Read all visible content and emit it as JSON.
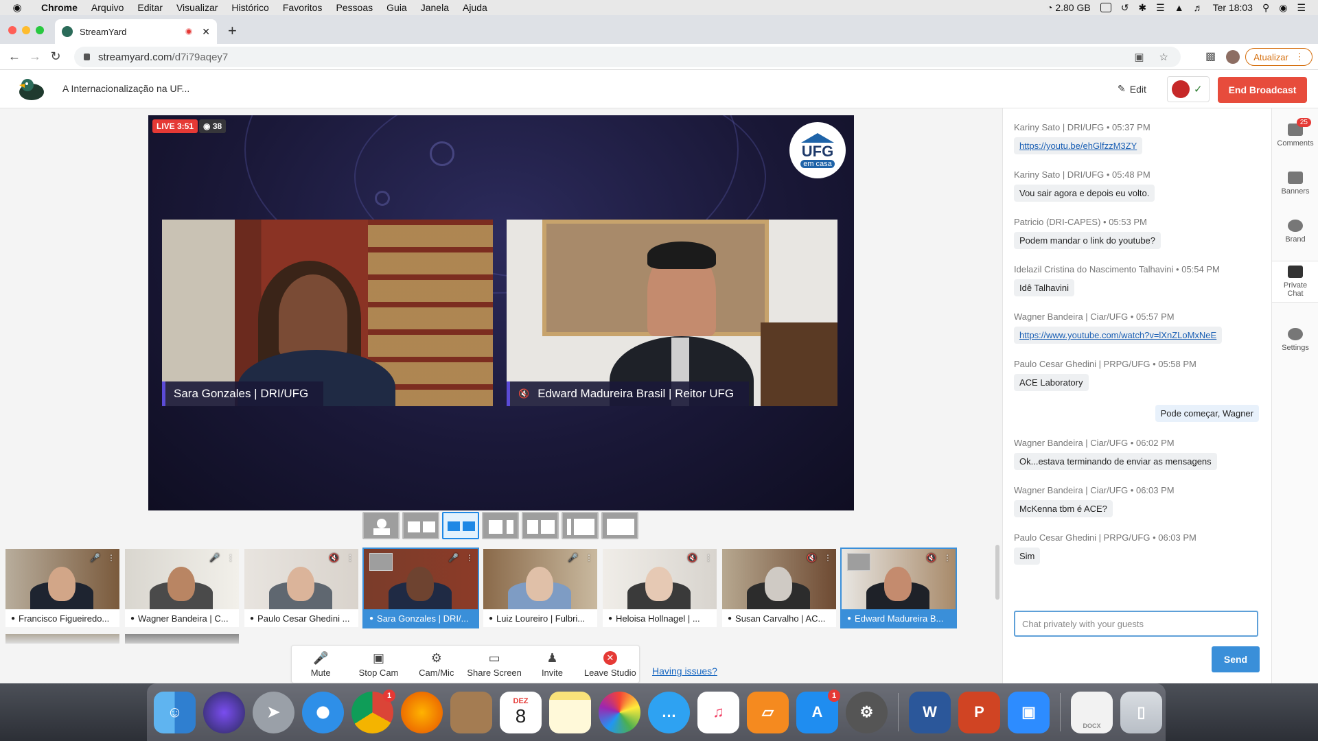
{
  "menubar": {
    "apple": "",
    "items": [
      "Chrome",
      "Arquivo",
      "Editar",
      "Visualizar",
      "Histórico",
      "Favoritos",
      "Pessoas",
      "Guia",
      "Janela",
      "Ajuda"
    ],
    "memory": "2.80 GB",
    "clock": "Ter 18:03"
  },
  "browser": {
    "tab_title": "StreamYard",
    "new_tab": "+",
    "url_host": "streamyard.com",
    "url_path": "/d7i79aqey7",
    "update_label": "Atualizar"
  },
  "app": {
    "broadcast_title": "A Internacionalização na UF...",
    "edit_label": "Edit",
    "end_broadcast_label": "End Broadcast"
  },
  "stage": {
    "live_label": "LIVE 3:51",
    "viewers": "38",
    "logo_main": "UFG",
    "logo_sub": "em casa",
    "videos": [
      {
        "name": "Sara Gonzales | DRI/UFG",
        "muted": false
      },
      {
        "name": "Edward Madureira Brasil | Reitor UFG",
        "muted": true
      }
    ]
  },
  "participants": [
    {
      "label": "Francisco Figueiredo...",
      "on_stage": false
    },
    {
      "label": "Wagner Bandeira | C...",
      "on_stage": false
    },
    {
      "label": "Paulo Cesar Ghedini ...",
      "on_stage": false
    },
    {
      "label": "Sara Gonzales | DRI/...",
      "on_stage": true
    },
    {
      "label": "Luiz Loureiro | Fulbri...",
      "on_stage": false
    },
    {
      "label": "Heloisa Hollnagel | ...",
      "on_stage": false
    },
    {
      "label": "Susan Carvalho | AC...",
      "on_stage": false
    },
    {
      "label": "Edward Madureira B...",
      "on_stage": true
    }
  ],
  "controls": {
    "mute": "Mute",
    "stop_cam": "Stop Cam",
    "cam_mic": "Cam/Mic",
    "share_screen": "Share Screen",
    "invite": "Invite",
    "leave": "Leave Studio",
    "issues": "Having issues?"
  },
  "chat": {
    "messages": [
      {
        "author": "Kariny Sato | DRI/UFG",
        "time": "05:37 PM",
        "text": "https://youtu.be/ehGlfzzM3ZY",
        "link": true
      },
      {
        "author": "Kariny Sato | DRI/UFG",
        "time": "05:48 PM",
        "text": "Vou sair agora e depois eu volto.",
        "link": false
      },
      {
        "author": "Patricio (DRI-CAPES)",
        "time": "05:53 PM",
        "text": "Podem mandar o link do youtube?",
        "link": false
      },
      {
        "author": "Idelazil Cristina do Nascimento Talhavini",
        "time": "05:54 PM",
        "text": "Idê Talhavini",
        "link": false
      },
      {
        "author": "Wagner Bandeira | Ciar/UFG",
        "time": "05:57 PM",
        "text": "https://www.youtube.com/watch?v=lXnZLoMxNeE",
        "link": true
      },
      {
        "author": "Paulo Cesar Ghedini | PRPG/UFG",
        "time": "05:58 PM",
        "text": "ACE Laboratory",
        "link": false
      },
      {
        "author": "Wagner Bandeira | Ciar/UFG",
        "time": "06:02 PM",
        "text": "Ok...estava terminando de enviar as mensagens",
        "link": false
      },
      {
        "author": "Wagner Bandeira | Ciar/UFG",
        "time": "06:03 PM",
        "text": "McKenna tbm é ACE?",
        "link": false
      },
      {
        "author": "Paulo Cesar Ghedini | PRPG/UFG",
        "time": "06:03 PM",
        "text": "Sim",
        "link": false
      }
    ],
    "own_message": "Pode começar, Wagner",
    "input_placeholder": "Chat privately with your guests",
    "send_label": "Send"
  },
  "rail": {
    "comments": "Comments",
    "comments_badge": "25",
    "banners": "Banners",
    "brand": "Brand",
    "private_chat": "Private Chat",
    "settings": "Settings"
  },
  "dock": {
    "calendar_month": "DEZ",
    "calendar_day": "8",
    "chrome_badge": "1",
    "appstore_badge": "1",
    "docx_label": "DOCX"
  }
}
